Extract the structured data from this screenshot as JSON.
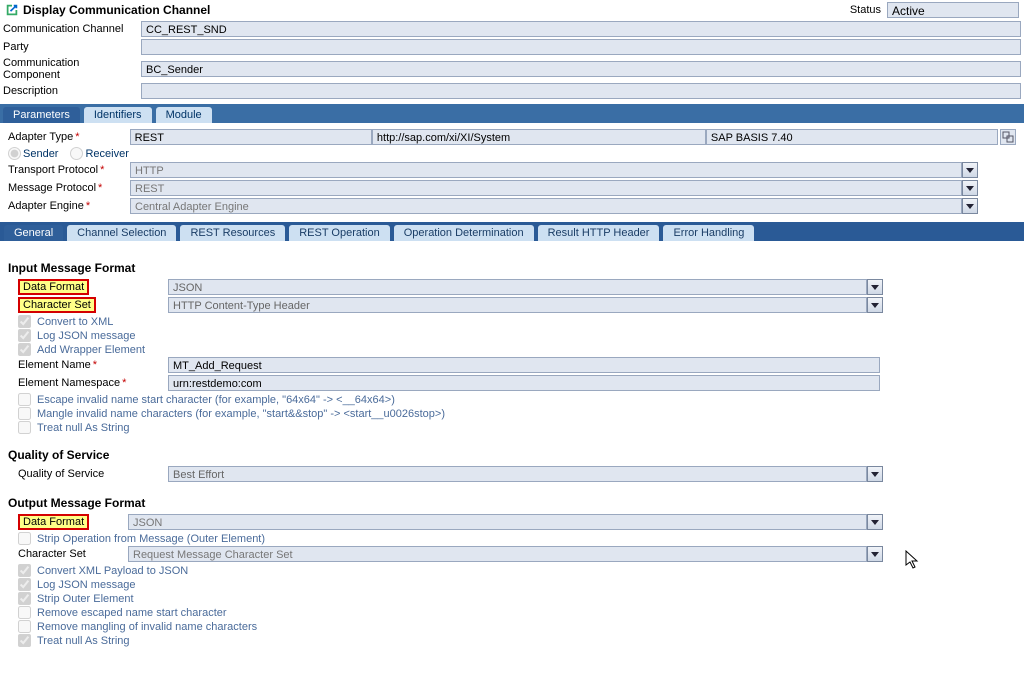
{
  "title": "Display Communication Channel",
  "status_label": "Status",
  "status_value": "Active",
  "header": {
    "comm_channel_label": "Communication Channel",
    "comm_channel_value": "CC_REST_SND",
    "party_label": "Party",
    "party_value": "",
    "comm_component_label": "Communication Component",
    "comm_component_value": "BC_Sender",
    "description_label": "Description",
    "description_value": ""
  },
  "tabs_main": {
    "parameters": "Parameters",
    "identifiers": "Identifiers",
    "module": "Module"
  },
  "adapter": {
    "label": "Adapter Type",
    "type": "REST",
    "url": "http://sap.com/xi/XI/System",
    "version": "SAP BASIS 7.40"
  },
  "direction": {
    "sender": "Sender",
    "receiver": "Receiver"
  },
  "protocols": {
    "transport_label": "Transport Protocol",
    "transport_value": "HTTP",
    "message_label": "Message Protocol",
    "message_value": "REST",
    "engine_label": "Adapter Engine",
    "engine_value": "Central Adapter Engine"
  },
  "tabs_sub": {
    "general": "General",
    "channel_selection": "Channel Selection",
    "rest_resources": "REST Resources",
    "rest_operation": "REST Operation",
    "operation_determination": "Operation Determination",
    "result_http_header": "Result HTTP Header",
    "error_handling": "Error Handling"
  },
  "input_msg": {
    "heading": "Input Message Format",
    "data_format_label": "Data Format",
    "data_format_value": "JSON",
    "charset_label": "Character Set",
    "charset_value": "HTTP Content-Type Header",
    "chk_convert_xml": "Convert to XML",
    "chk_log_json": "Log JSON message",
    "chk_add_wrapper": "Add Wrapper Element",
    "element_name_label": "Element Name",
    "element_name_value": "MT_Add_Request",
    "element_ns_label": "Element Namespace",
    "element_ns_value": "urn:restdemo:com",
    "chk_escape": "Escape invalid name start character (for example, \"64x64\" -> <__64x64>)",
    "chk_mangle": "Mangle invalid name characters (for example, \"start&&stop\" -> <start__u0026stop>)",
    "chk_treat_null": "Treat null As String"
  },
  "qos": {
    "heading": "Quality of Service",
    "label": "Quality of Service",
    "value": "Best Effort"
  },
  "output_msg": {
    "heading": "Output Message Format",
    "data_format_label": "Data Format",
    "data_format_value": "JSON",
    "chk_strip_op": "Strip Operation from Message (Outer Element)",
    "charset_label": "Character Set",
    "charset_value": "Request Message Character Set",
    "chk_convert_json": "Convert XML Payload to JSON",
    "chk_log_json": "Log JSON message",
    "chk_strip_outer": "Strip Outer Element",
    "chk_remove_escaped": "Remove escaped name start character",
    "chk_remove_mangling": "Remove mangling of invalid name characters",
    "chk_treat_null": "Treat null As String"
  }
}
